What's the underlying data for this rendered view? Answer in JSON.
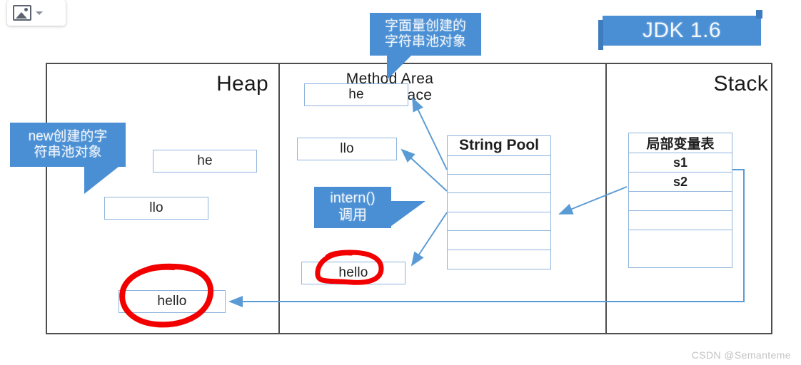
{
  "toolbar": {
    "image_icon": "image-icon",
    "dropdown_icon": "chevron-down-icon"
  },
  "badge": {
    "jdk_label": "JDK 1.6"
  },
  "regions": {
    "heap_title": "Heap",
    "method_area_title": "Method Area\nPerm Space",
    "stack_title": "Stack"
  },
  "heap": {
    "boxes": [
      {
        "label": "he"
      },
      {
        "label": "llo"
      },
      {
        "label": "hello"
      }
    ]
  },
  "method_area": {
    "boxes": [
      {
        "label": "he"
      },
      {
        "label": "llo"
      },
      {
        "label": "hello"
      }
    ],
    "string_pool": {
      "header": "String Pool",
      "rows": [
        "",
        "",
        "",
        "",
        "",
        ""
      ]
    }
  },
  "stack": {
    "local_var_table": {
      "header": "局部变量表",
      "rows": [
        "s1",
        "s2",
        "",
        "",
        ""
      ]
    }
  },
  "callouts": {
    "literal": {
      "line1": "字面量创建的",
      "line2": "字符串池对象"
    },
    "new": {
      "line1": "new创建的字",
      "line2": "符串池对象"
    },
    "intern": {
      "line1": "intern()",
      "line2": "调用"
    }
  },
  "annotations": {
    "circle_heap_hello": "red-circle-annotation",
    "circle_perm_hello": "red-circle-annotation"
  },
  "colors": {
    "accent_blue": "#4a8fd4",
    "box_border_blue": "#8fb4dd",
    "arrow_blue": "#5b9bd5",
    "frame_dark": "#4d4d4d",
    "annotation_red": "#f20000",
    "watermark_grey": "#c3c3c3"
  },
  "watermark": "CSDN @Semanteme"
}
